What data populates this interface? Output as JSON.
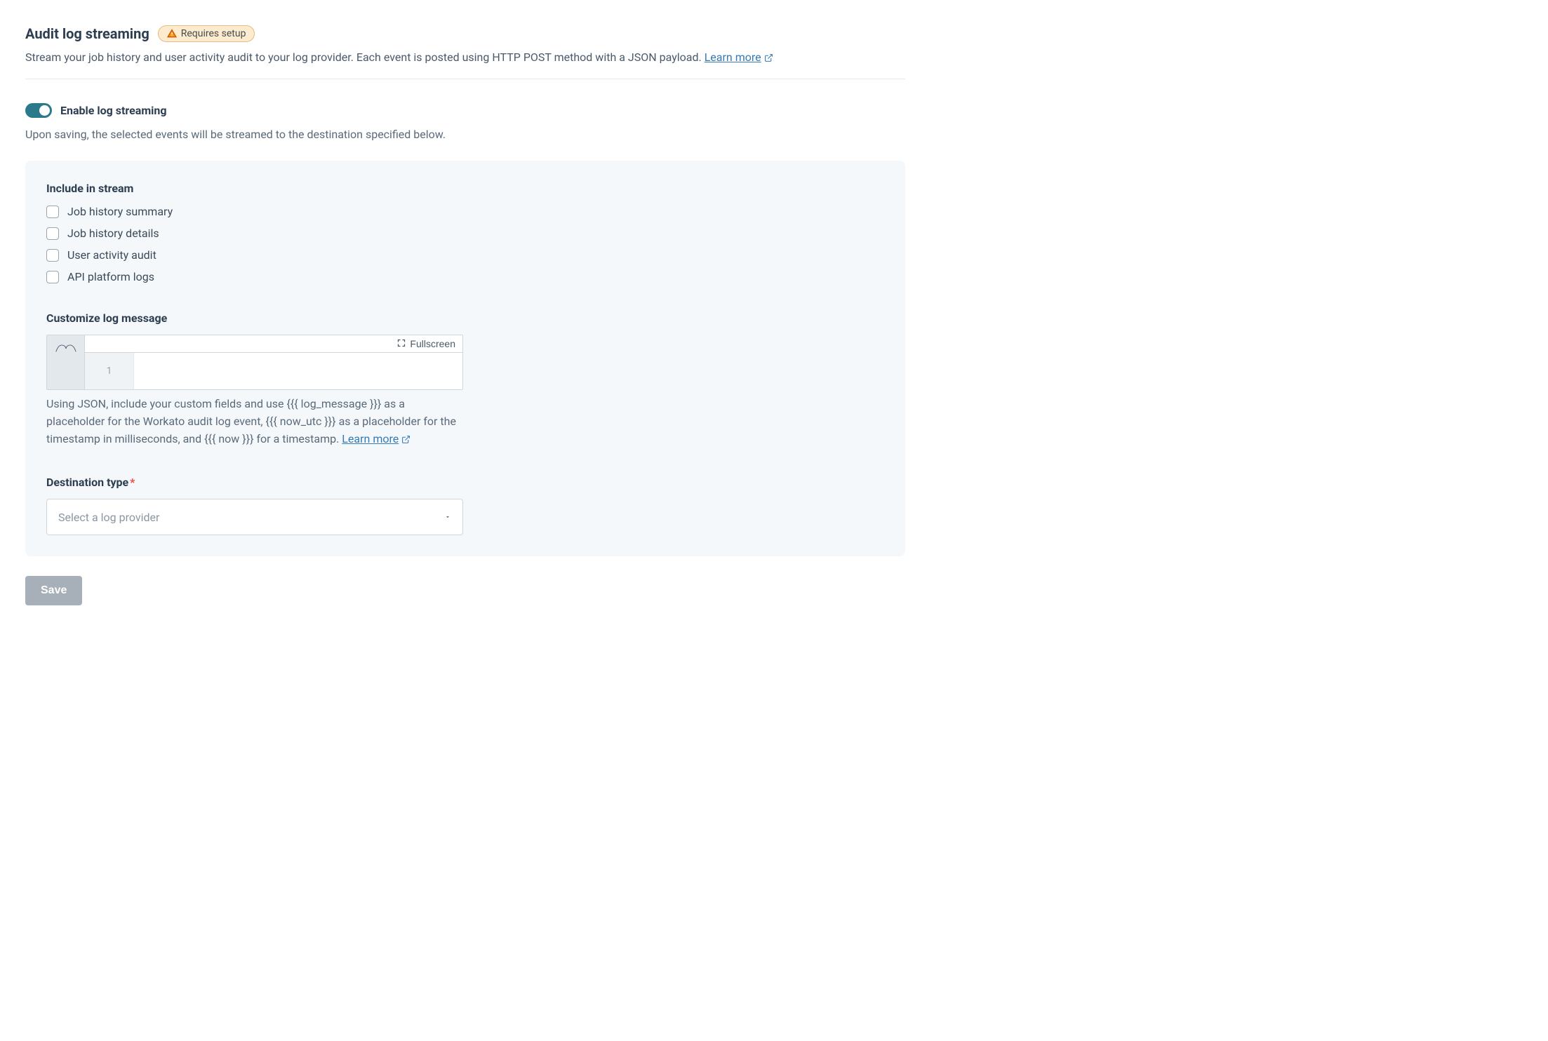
{
  "header": {
    "title": "Audit log streaming",
    "badge_label": "Requires setup",
    "description": "Stream your job history and user activity audit to your log provider. Each event is posted using HTTP POST method with a JSON payload. ",
    "learn_more_label": "Learn more"
  },
  "toggle": {
    "label": "Enable log streaming",
    "helper": "Upon saving, the selected events will be streamed to the destination specified below.",
    "enabled": true
  },
  "include": {
    "title": "Include in stream",
    "options": [
      {
        "label": "Job history summary",
        "checked": false
      },
      {
        "label": "Job history details",
        "checked": false
      },
      {
        "label": "User activity audit",
        "checked": false
      },
      {
        "label": "API platform logs",
        "checked": false
      }
    ]
  },
  "customize": {
    "title": "Customize log message",
    "fullscreen_label": "Fullscreen",
    "line_number": "1",
    "help_text": "Using JSON, include your custom fields and use {{{ log_message }}} as a placeholder for the Workato audit log event, {{{ now_utc }}} as a placeholder for the timestamp in milliseconds, and {{{ now }}} for a timestamp. ",
    "learn_more_label": "Learn more"
  },
  "destination": {
    "title": "Destination type",
    "placeholder": "Select a log provider"
  },
  "actions": {
    "save_label": "Save"
  }
}
